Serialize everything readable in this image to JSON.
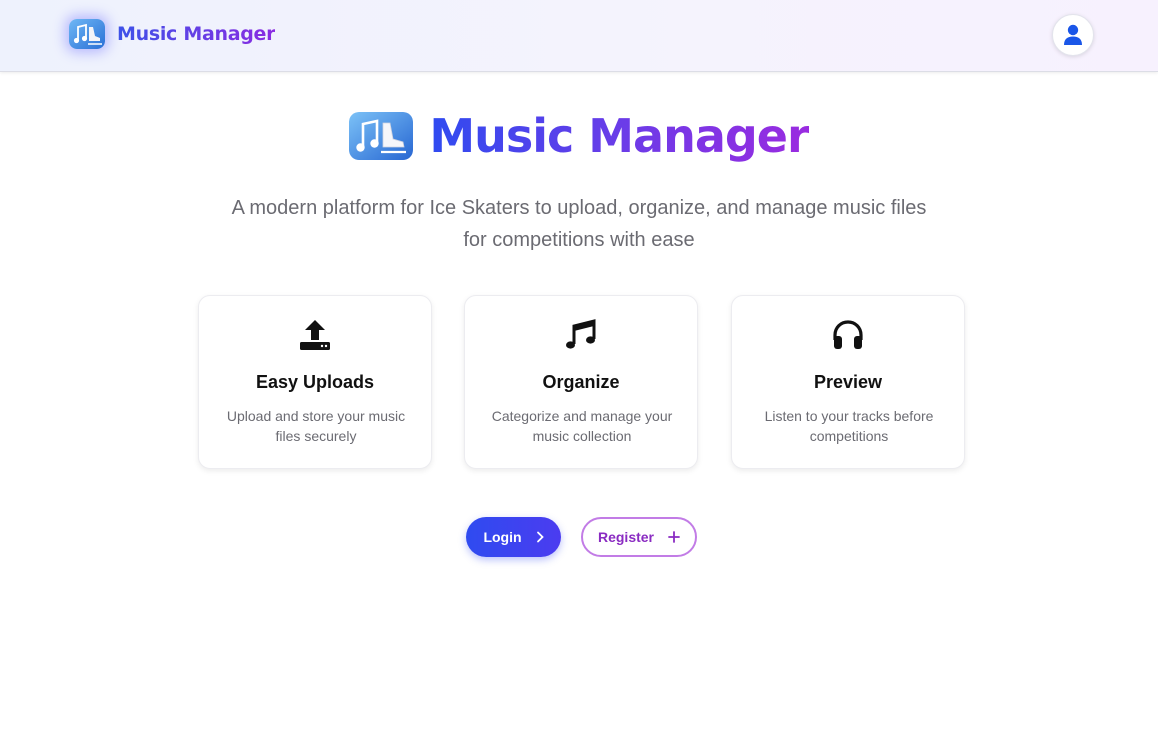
{
  "nav": {
    "title": "Music Manager",
    "logo_icon": "music-skate-logo-icon",
    "profile_icon": "user-icon",
    "profile_color": "#1a56e8"
  },
  "hero": {
    "title": "Music Manager",
    "subtitle": "A modern platform for Ice Skaters to upload, organize, and manage music files for competitions with ease"
  },
  "features": [
    {
      "icon": "upload-icon",
      "title": "Easy Uploads",
      "description": "Upload and store your music files securely"
    },
    {
      "icon": "music-note-icon",
      "title": "Organize",
      "description": "Categorize and manage your music collection"
    },
    {
      "icon": "headphones-icon",
      "title": "Preview",
      "description": "Listen to your tracks before competitions"
    }
  ],
  "actions": {
    "login_label": "Login",
    "login_icon": "chevron-right-icon",
    "register_label": "Register",
    "register_icon": "plus-icon"
  },
  "colors": {
    "accent_blue": "#2f4bf0",
    "accent_purple": "#8a2be2"
  }
}
